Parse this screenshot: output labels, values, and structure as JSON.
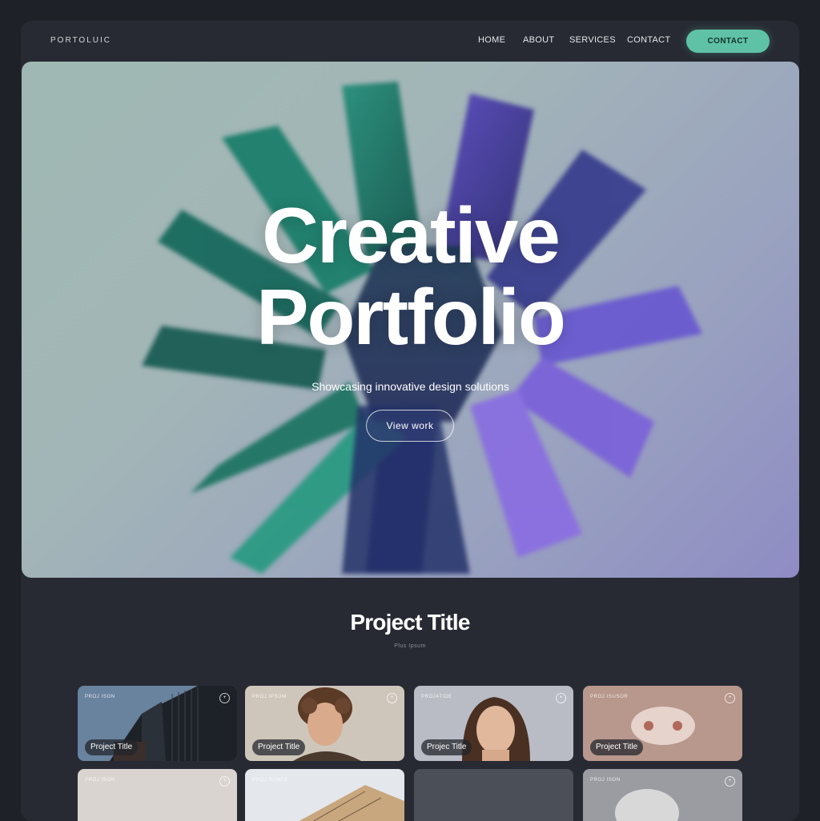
{
  "nav": {
    "brand": "PORTOLUIC",
    "links": [
      "HOME",
      "ABOUT",
      "SERVICES",
      "CONTACT"
    ],
    "cta": "CONTACT"
  },
  "hero": {
    "title_line1": "Creative",
    "title_line2": "Portfolio",
    "subtitle": "Showcasing innovative design solutions",
    "button": "View work"
  },
  "section": {
    "title": "Project Title",
    "subtitle": "Plus Ipsum"
  },
  "cards": [
    {
      "tag": "PROJ ISON",
      "label": "Project Title"
    },
    {
      "tag": "PROJ IPSUM",
      "label": "Project Title"
    },
    {
      "tag": "PROJATIDE",
      "label": "Projec Title"
    },
    {
      "tag": "PROJ ISUSOR",
      "label": "Project Title"
    },
    {
      "tag": "PROJ ISON",
      "label": ""
    },
    {
      "tag": "PROJ SONCE",
      "label": ""
    },
    {
      "tag": "",
      "label": ""
    },
    {
      "tag": "PROJ ISON",
      "label": ""
    }
  ],
  "colors": {
    "accent": "#5fc2a6",
    "background": "#272a33",
    "teal_shape": "#1f7b6c",
    "violet_shape": "#6b57c9"
  }
}
